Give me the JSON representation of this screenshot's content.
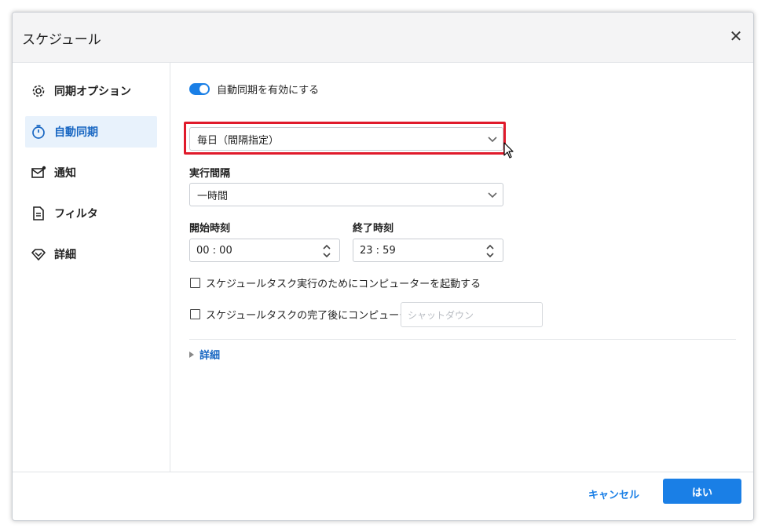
{
  "dialog": {
    "title": "スケジュール",
    "close_label": "✕"
  },
  "sidebar": {
    "items": [
      {
        "label": "同期オプション",
        "icon": "gear-icon"
      },
      {
        "label": "自動同期",
        "icon": "timer-icon",
        "active": true
      },
      {
        "label": "通知",
        "icon": "mail-icon"
      },
      {
        "label": "フィルタ",
        "icon": "document-icon"
      },
      {
        "label": "詳細",
        "icon": "diamond-icon"
      }
    ]
  },
  "main": {
    "auto_sync_toggle_label": "自動同期を有効にする",
    "auto_sync_enabled": true,
    "schedule_type_value": "毎日（間隔指定）",
    "interval_label": "実行間隔",
    "interval_value": "一時間",
    "start_time_label": "開始時刻",
    "start_time_value": "00 : 00",
    "end_time_label": "終了時刻",
    "end_time_value": "23 : 59",
    "wake_checkbox_label": "スケジュールタスク実行のためにコンピューターを起動する",
    "after_checkbox_label": "スケジュールタスクの完了後にコンピューターを",
    "after_action_placeholder": "シャットダウン",
    "details_label": "詳細"
  },
  "footer": {
    "cancel_label": "キャンセル",
    "ok_label": "はい"
  },
  "colors": {
    "accent": "#1a7fe6",
    "highlight": "#e01a2b",
    "active_bg": "#e8f2fc"
  }
}
